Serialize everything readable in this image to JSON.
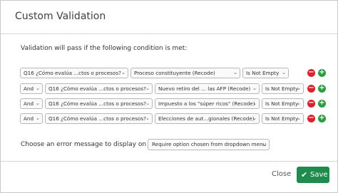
{
  "dialog": {
    "title": "Custom Validation"
  },
  "intro_text": "Validation will pass if the following condition is met:",
  "conditions": [
    {
      "conjunction": "",
      "question": "Q16 ¿Cómo evalúa ...ctos o procesos?",
      "choice": "Proceso constituyente (Recode)",
      "operator": "Is Not Empty"
    },
    {
      "conjunction": "And",
      "question": "Q16 ¿Cómo evalúa ...ctos o procesos?",
      "choice": "Nuevo retiro del ... las AFP (Recode)",
      "operator": "Is Not Empty"
    },
    {
      "conjunction": "And",
      "question": "Q16 ¿Cómo evalúa ...ctos o procesos?",
      "choice": "Impuesto a los \"súper ricos\" (Recode)",
      "operator": "Is Not Empty"
    },
    {
      "conjunction": "And",
      "question": "Q16 ¿Cómo evalúa ...ctos o procesos?",
      "choice": "Elecciones de aut...gionales (Recode)",
      "operator": "Is Not Empty"
    }
  ],
  "error": {
    "label": "Choose an error message to display on failure:",
    "value": "Require option chosen from dropdown menu"
  },
  "footer": {
    "close_label": "Close",
    "save_label": "Save"
  },
  "icons": {
    "remove": "minus-circle-icon",
    "add": "plus-circle-icon",
    "chevron": "chevron-down-icon",
    "check": "check-icon"
  },
  "colors": {
    "remove": "#d9232f",
    "add": "#2e9b3f",
    "save": "#1f8b4c"
  }
}
